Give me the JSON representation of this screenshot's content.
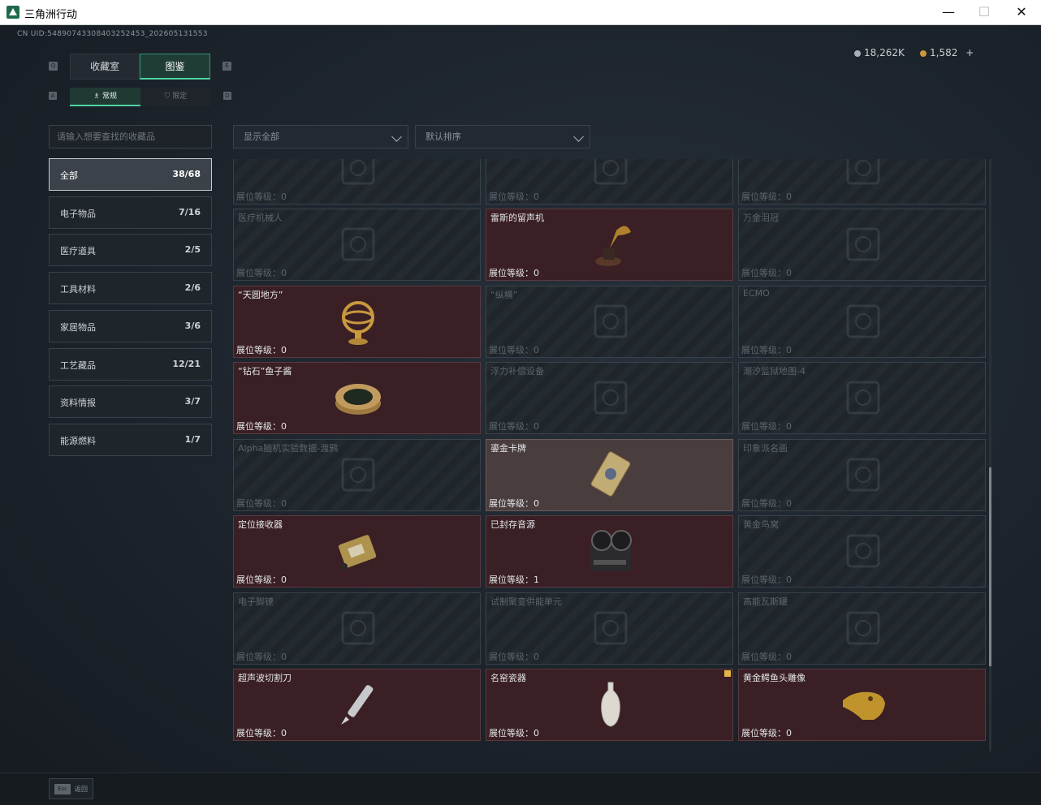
{
  "window": {
    "title": "三角洲行动",
    "minimize": "—",
    "maximize": "☐",
    "close": "✕"
  },
  "uid": "CN UID:5489074330840​32524​53_202605131553",
  "currency": {
    "coins": "18,262K",
    "gold": "1,582",
    "add": "+"
  },
  "tabs": [
    {
      "label": "收藏室"
    },
    {
      "label": "图鉴"
    }
  ],
  "subtabs": [
    {
      "label": "常规"
    },
    {
      "label": "限定"
    }
  ],
  "keyhints": {
    "tab_prev": "Q",
    "tab_next": "E",
    "sub_prev": "A",
    "sub_next": "D"
  },
  "search": {
    "placeholder": "请输入想要查找的收藏品"
  },
  "filters": {
    "show": "显示全部",
    "sort": "默认排序"
  },
  "categories": [
    {
      "label": "全部",
      "count": "38/68"
    },
    {
      "label": "电子物品",
      "count": "7/16"
    },
    {
      "label": "医疗道具",
      "count": "2/5"
    },
    {
      "label": "工具材料",
      "count": "2/6"
    },
    {
      "label": "家居物品",
      "count": "3/6"
    },
    {
      "label": "工艺藏品",
      "count": "12/21"
    },
    {
      "label": "资料情报",
      "count": "3/7"
    },
    {
      "label": "能源燃料",
      "count": "1/7"
    }
  ],
  "level_prefix": "展位等级：",
  "items": [
    {
      "name": "",
      "level": "0",
      "state": "locked",
      "icon": "crate-icon"
    },
    {
      "name": "",
      "level": "0",
      "state": "locked",
      "icon": "crate-icon"
    },
    {
      "name": "",
      "level": "0",
      "state": "locked",
      "icon": "crate-icon"
    },
    {
      "name": "医疗机械人",
      "level": "0",
      "state": "locked",
      "icon": "robot-icon"
    },
    {
      "name": "雷斯的留声机",
      "level": "0",
      "state": "owned",
      "icon": "gramophone-icon"
    },
    {
      "name": "万金泪冠",
      "level": "0",
      "state": "locked",
      "icon": "crown-icon"
    },
    {
      "name": "“天圆地方”",
      "level": "0",
      "state": "owned",
      "icon": "armillary-icon"
    },
    {
      "name": "“纵横”",
      "level": "0",
      "state": "locked",
      "icon": "box-icon"
    },
    {
      "name": "ECMO",
      "level": "0",
      "state": "locked",
      "icon": "device-icon"
    },
    {
      "name": "“钻石”鱼子酱",
      "level": "0",
      "state": "owned",
      "icon": "caviar-icon"
    },
    {
      "name": "浮力补偿设备",
      "level": "0",
      "state": "locked",
      "icon": "vest-icon"
    },
    {
      "name": "潮汐监狱地图-4",
      "level": "0",
      "state": "locked",
      "icon": "map-icon"
    },
    {
      "name": "Alpha脑机实验数据-渡鸦",
      "level": "0",
      "state": "locked",
      "icon": "drive-icon"
    },
    {
      "name": "鎏金卡牌",
      "level": "0",
      "state": "highlight",
      "icon": "card-icon"
    },
    {
      "name": "印象派名画",
      "level": "0",
      "state": "locked",
      "icon": "painting-icon"
    },
    {
      "name": "定位接收器",
      "level": "0",
      "state": "owned",
      "icon": "receiver-icon"
    },
    {
      "name": "已封存音源",
      "level": "1",
      "state": "owned",
      "icon": "reel-icon"
    },
    {
      "name": "黄金鸟窝",
      "level": "0",
      "state": "locked",
      "icon": "nest-icon"
    },
    {
      "name": "电子脚镣",
      "level": "0",
      "state": "locked",
      "icon": "shackle-icon"
    },
    {
      "name": "试制聚变供能单元",
      "level": "0",
      "state": "locked",
      "icon": "reactor-icon"
    },
    {
      "name": "高能瓦斯罐",
      "level": "0",
      "state": "locked",
      "icon": "canister-icon"
    },
    {
      "name": "超声波切割刀",
      "level": "0",
      "state": "owned",
      "icon": "knife-icon"
    },
    {
      "name": "名窑瓷器",
      "level": "0",
      "state": "owned",
      "icon": "vase-icon",
      "flag": true
    },
    {
      "name": "黄金鳄鱼头雕像",
      "level": "0",
      "state": "owned",
      "icon": "croc-icon"
    }
  ],
  "footer": {
    "key": "Esc",
    "label": "返回"
  }
}
